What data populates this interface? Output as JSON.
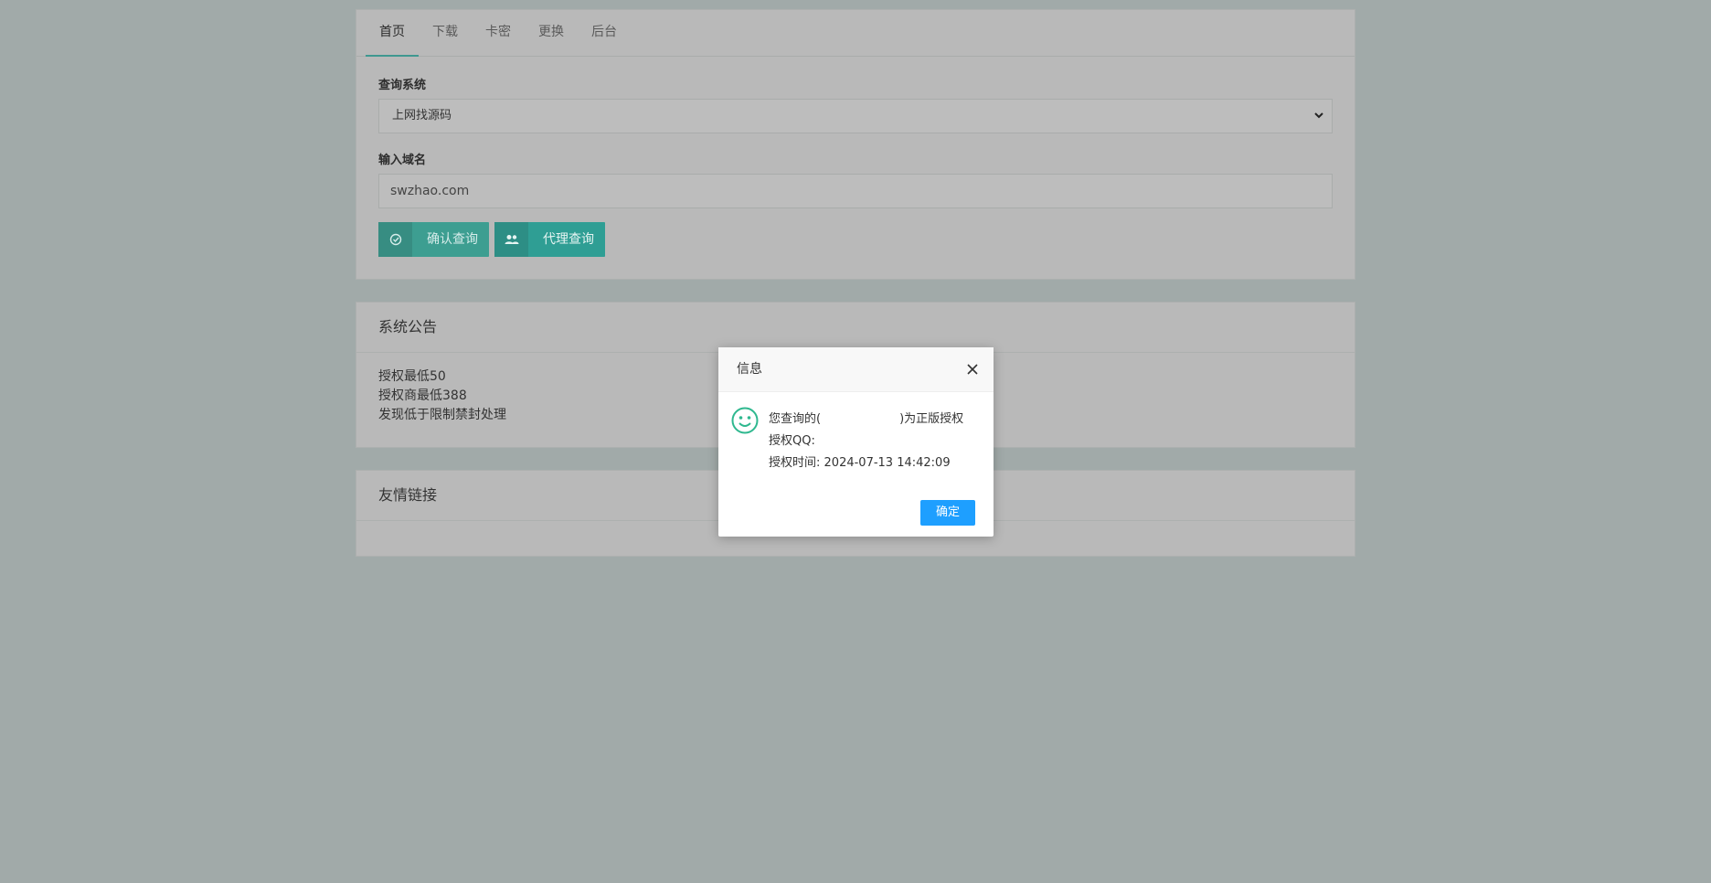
{
  "tabs": [
    {
      "label": "首页"
    },
    {
      "label": "下载"
    },
    {
      "label": "卡密"
    },
    {
      "label": "更换"
    },
    {
      "label": "后台"
    }
  ],
  "query": {
    "system_label": "查询系统",
    "system_selected": "上网找源码",
    "domain_label": "输入域名",
    "domain_value": "swzhao.com",
    "confirm_button": "确认查询",
    "agent_button": "代理查询"
  },
  "notice": {
    "title": "系统公告",
    "lines": [
      "授权最低50",
      "授权商最低388",
      "发现低于限制禁封处理"
    ]
  },
  "links": {
    "title": "友情链接"
  },
  "dialog": {
    "title": "信息",
    "line1_prefix": "您查询的(",
    "line1_suffix": ")为正版授权",
    "line2": "授权QQ:",
    "line3_label": "授权时间:",
    "line3_value": "2024-07-13 14:42:09",
    "ok_button": "确定"
  },
  "colors": {
    "accent": "#3d9e91",
    "dialog_button": "#1e9fff",
    "smile_icon": "#2fb88f"
  },
  "icons": {
    "confirm": "check-circle-icon",
    "agent": "users-icon",
    "close": "close-icon",
    "status": "smile-icon"
  }
}
